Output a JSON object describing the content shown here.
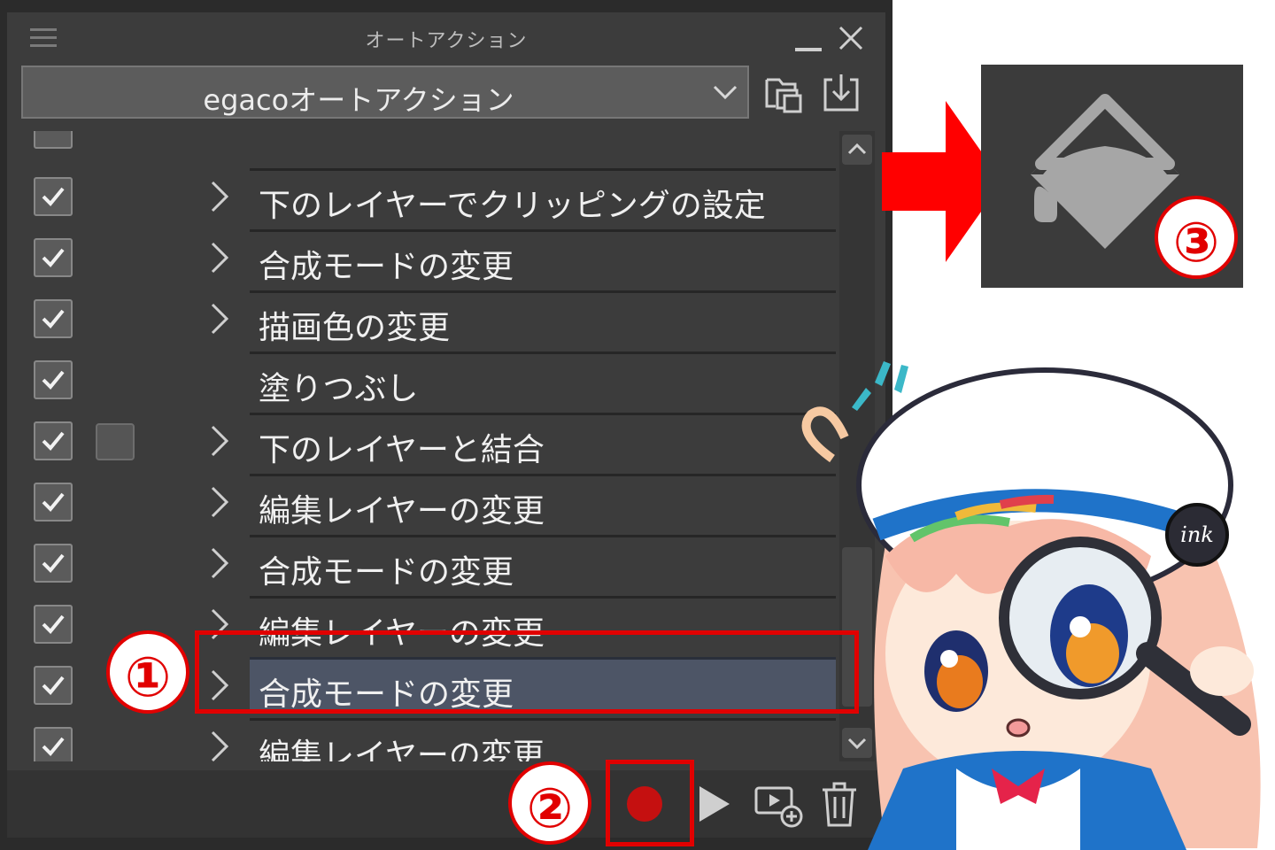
{
  "panel": {
    "title": "オートアクション",
    "set_name": "egacoオートアクション"
  },
  "actions": [
    {
      "label": "下のレイヤーでクリッピングの設定",
      "checked": true,
      "expandable": true
    },
    {
      "label": "合成モードの変更",
      "checked": true,
      "expandable": true
    },
    {
      "label": "描画色の変更",
      "checked": true,
      "expandable": true
    },
    {
      "label": "塗りつぶし",
      "checked": true,
      "expandable": false
    },
    {
      "label": "下のレイヤーと結合",
      "checked": true,
      "expandable": true,
      "modal_box": true
    },
    {
      "label": "編集レイヤーの変更",
      "checked": true,
      "expandable": true
    },
    {
      "label": "合成モードの変更",
      "checked": true,
      "expandable": true
    },
    {
      "label": "編集レイヤーの変更",
      "checked": true,
      "expandable": true
    },
    {
      "label": "合成モードの変更",
      "checked": true,
      "expandable": true,
      "selected": true
    },
    {
      "label": "編集レイヤーの変更",
      "checked": true,
      "expandable": true
    }
  ],
  "annotations": {
    "step1": "①",
    "step2": "②",
    "step3": "③"
  },
  "mascot": {
    "badge_text": "ink"
  },
  "colors": {
    "annotation_red": "#e10000",
    "record_red": "#c51010",
    "selected_row": "#4d5566",
    "panel_bg": "#3c3c3c"
  },
  "icons": [
    "menu-icon",
    "minimize-icon",
    "close-icon",
    "chevron-down-icon",
    "new-set-folder-icon",
    "import-icon",
    "scroll-up-icon",
    "scroll-down-icon",
    "record-icon",
    "play-icon",
    "add-command-icon",
    "trash-icon",
    "fill-bucket-icon",
    "right-arrow-icon"
  ]
}
